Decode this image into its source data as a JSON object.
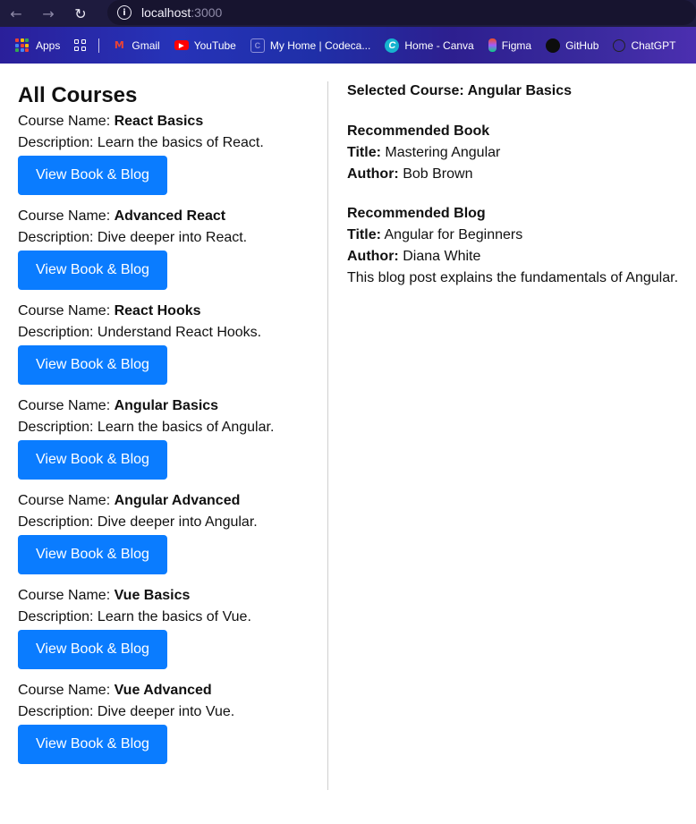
{
  "browser": {
    "url_host": "localhost",
    "url_port": ":3000",
    "bookmarks": [
      {
        "label": "Apps",
        "icon": "apps-grid-icon"
      },
      {
        "label": "Gmail",
        "icon": "gmail-icon"
      },
      {
        "label": "YouTube",
        "icon": "youtube-icon"
      },
      {
        "label": "My Home | Codeca...",
        "icon": "codecademy-icon"
      },
      {
        "label": "Home - Canva",
        "icon": "canva-icon"
      },
      {
        "label": "Figma",
        "icon": "figma-icon"
      },
      {
        "label": "GitHub",
        "icon": "github-icon"
      },
      {
        "label": "ChatGPT",
        "icon": "chatgpt-icon"
      }
    ]
  },
  "courses_panel": {
    "title": "All Courses",
    "name_prefix": "Course Name: ",
    "desc_prefix": "Description: ",
    "button_label": "View Book & Blog",
    "courses": [
      {
        "name": "React Basics",
        "description": "Learn the basics of React."
      },
      {
        "name": "Advanced React",
        "description": "Dive deeper into React."
      },
      {
        "name": "React Hooks",
        "description": "Understand React Hooks."
      },
      {
        "name": "Angular Basics",
        "description": "Learn the basics of Angular."
      },
      {
        "name": "Angular Advanced",
        "description": "Dive deeper into Angular."
      },
      {
        "name": "Vue Basics",
        "description": "Learn the basics of Vue."
      },
      {
        "name": "Vue Advanced",
        "description": "Dive deeper into Vue."
      }
    ]
  },
  "details_panel": {
    "selected_label": "Selected Course: ",
    "selected_course": "Angular Basics",
    "book": {
      "heading": "Recommended Book",
      "title_label": "Title:",
      "title": "Mastering Angular",
      "author_label": "Author:",
      "author": "Bob Brown"
    },
    "blog": {
      "heading": "Recommended Blog",
      "title_label": "Title:",
      "title": "Angular for Beginners",
      "author_label": "Author:",
      "author": "Diana White",
      "summary": "This blog post explains the fundamentals of Angular."
    }
  },
  "colors": {
    "button_bg": "#0a7cff",
    "chrome_bg": "#1e1b3e"
  }
}
